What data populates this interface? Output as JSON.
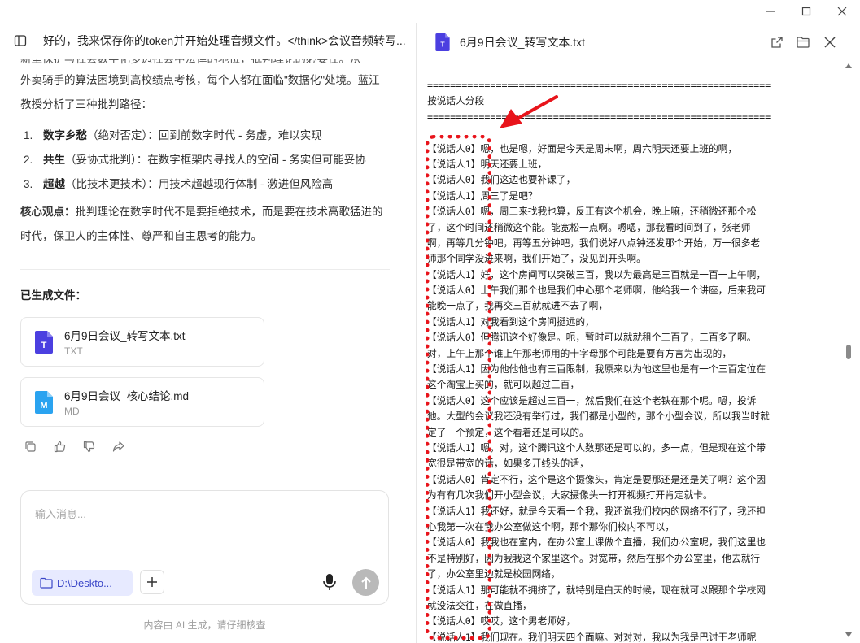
{
  "window": {
    "min_label": "minimize",
    "max_label": "maximize",
    "close_label": "close"
  },
  "chat": {
    "title": "好的，我来保存你的token并开始处理音频文件。</think>会议音频转写...",
    "clipped_text": "新型保护与社会数字化多边社会中法律的地位，批判理论的必要性。从",
    "para1": "外卖骑手的算法困境到高校绩点考核，每个人都在面临\"数据化\"处境。蓝江教授分析了三种批判路径：",
    "items": [
      {
        "num": "1.",
        "bold": "数字乡愁",
        "rest": "（绝对否定）：回到前数字时代 - 务虚，难以实现"
      },
      {
        "num": "2.",
        "bold": "共生",
        "rest": "（妥协式批判）：在数字框架内寻找人的空间 - 务实但可能妥协"
      },
      {
        "num": "3.",
        "bold": "超越",
        "rest": "（比技术更技术）：用技术超越现行体制 - 激进但风险高"
      }
    ],
    "core_label": "核心观点：",
    "core_text": "批判理论在数字时代不是要拒绝技术，而是要在技术高歌猛进的时代，保卫人的主体性、尊严和自主思考的能力。",
    "generated_label": "已生成文件：",
    "files": [
      {
        "name": "6月9日会议_转写文本.txt",
        "type": "TXT",
        "icon_letter": "T",
        "color": "#4b3fe0"
      },
      {
        "name": "6月9日会议_核心结论.md",
        "type": "MD",
        "icon_letter": "M",
        "color": "#2aa3f0"
      }
    ],
    "input_placeholder": "输入消息...",
    "path_chip": "D:\\Deskto...",
    "disclaimer": "内容由 AI 生成，请仔细核查"
  },
  "viewer": {
    "title": "6月9日会议_转写文本.txt",
    "lines": [
      "============================================================",
      "按说话人分段",
      "============================================================",
      "",
      "【说话人0】嗯，也是嗯，好面是今天是周末啊，周六明天还要上班的啊，",
      "【说话人1】明天还要上班，",
      "【说话人0】我们这边也要补课了，",
      "【说话人1】周三了是吧？",
      "【说话人0】嗯，周三来找我也算，反正有这个机会，晚上嘛，还稍微还那个松",
      "了，这个时间还稍微这个能。能宽松一点啊。嗯嗯，那我看时间到了，张老师",
      "啊，再等几分钟吧，再等五分钟吧，我们说好八点钟还发那个开始，万一很多老",
      "师那个同学没进来啊，我们开始了，没见到开头啊。",
      "【说话人1】好，这个房间可以突破三百，我以为最高是三百就是一百一上午啊，",
      "【说话人0】上午我们那个也是我们中心那个老师啊，他给我一个讲座，后来我可",
      "能晚一点了，我再交三百就就进不去了啊，",
      "【说话人1】对我看到这个房间挺远的，",
      "【说话人0】但腾讯这个好像是。呃，暂时可以就就租个三百了，三百多了啊。",
      "对，上午上那个谁上午那老师用的十字母那个可能是要有方言为出现的，",
      "【说话人1】因为他他他也有三百限制，我原来以为他这里也是有一个三百定位在",
      "这个淘宝上买的，就可以超过三百，",
      "【说话人0】这个应该是超过三百一，然后我们在这个老铁在那个呢。嗯，投诉",
      "他。大型的会议我还没有举行过，我们都是小型的，那个小型会议，所以我当时就",
      "定了一个预定，这个看着还是可以的。",
      "【说话人1】嗯，对，这个腾讯这个人数那还是可以的，多一点，但是现在这个带",
      "宽很是带宽的话，如果多开线头的话，",
      "【说话人0】肯定不行，这个是这个摄像头，肯定是要那还是还是关了啊？这个因",
      "为有有几次我们开小型会议，大家摄像头一打开视频打开肯定就卡。",
      "【说话人1】我还好，就是今天看一个我，我还说我们校内的网络不行了，我还担",
      "心我第一次在我办公室做这个啊，那个那你们校内不可以，",
      "【说话人0】我我也在室内，在办公室上课做个直播，我们办公室呢，我们这里也",
      "不是特别好，因为我我这个家里这个。对宽带，然后在那个办公室里，他去就行",
      "了，办公室里边就是校园网络，",
      "【说话人1】那可能就不拥挤了，就特别是白天的时候，现在就可以跟那个学校网",
      "就没法交往，在做直播，",
      "【说话人0】哎哎，这个男老师好，",
      "【说话人1】我们现在。我们明天四个面嘛。对对对，我以为我是巴讨于老师呢"
    ]
  }
}
